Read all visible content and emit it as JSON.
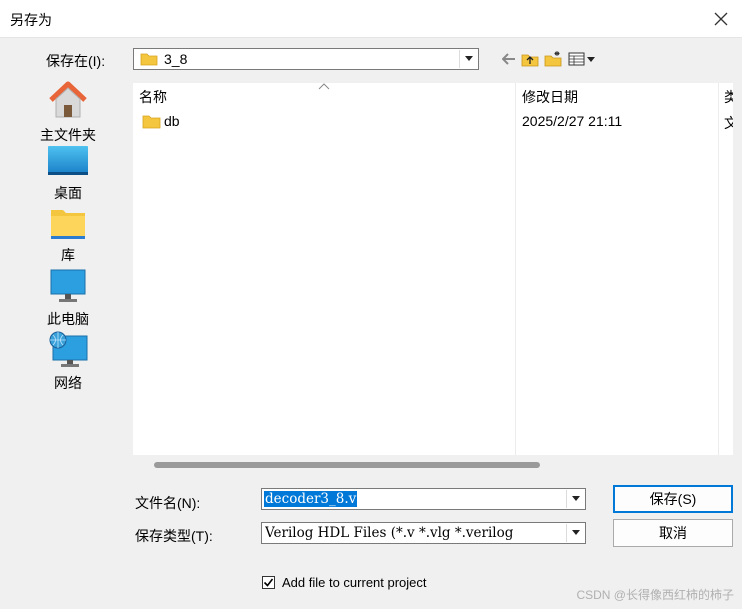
{
  "window": {
    "title": "另存为",
    "close_icon": "close-icon"
  },
  "location": {
    "label": "保存在(I):",
    "folder_name": "3_8"
  },
  "toolbar": {
    "icons": [
      "back-arrow-icon",
      "up-folder-icon",
      "new-folder-icon",
      "view-menu-icon"
    ]
  },
  "places": [
    {
      "label": "主文件夹",
      "icon": "home-icon"
    },
    {
      "label": "桌面",
      "icon": "desktop-icon"
    },
    {
      "label": "库",
      "icon": "library-icon"
    },
    {
      "label": "此电脑",
      "icon": "computer-icon"
    },
    {
      "label": "网络",
      "icon": "network-icon"
    }
  ],
  "file_list": {
    "columns": [
      "名称",
      "修改日期",
      "类"
    ],
    "rows": [
      {
        "name": "db",
        "modified": "2025/2/27 21:11",
        "type": "文"
      }
    ]
  },
  "filename": {
    "label": "文件名(N):",
    "value": "decoder3_8.v"
  },
  "filetype": {
    "label": "保存类型(T):",
    "value": "Verilog HDL Files (*.v *.vlg *.verilog"
  },
  "buttons": {
    "save": "保存(S)",
    "cancel": "取消"
  },
  "add_to_project": {
    "label": "Add file to current project",
    "checked": true
  },
  "watermark": "CSDN @长得像西红柿的柿子",
  "colors": {
    "accent": "#0078d7",
    "folder": "#f4c53e",
    "selection": "#0078d7"
  }
}
